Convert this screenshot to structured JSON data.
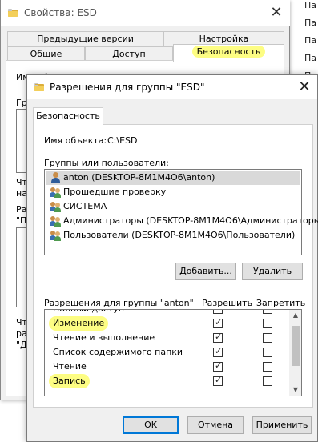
{
  "background_list": {
    "items": [
      "Па",
      "Па",
      "Па",
      "Па",
      "Па",
      "Па"
    ]
  },
  "back_dialog": {
    "title": "Свойства: ESD",
    "close": "✕",
    "tabs": [
      {
        "label": "Предыдущие версии"
      },
      {
        "label": "Настройка"
      },
      {
        "label": "Общие"
      },
      {
        "label": "Доступ"
      },
      {
        "label": "Безопасность"
      }
    ],
    "object_name_partial": "Имя объекта: C:\\ESD",
    "partial_texts": [
      "Группы",
      "Чте",
      "на",
      "Раз",
      "\"П",
      "Чте",
      "ра",
      "\"Д"
    ]
  },
  "front_dialog": {
    "title": "Разрешения для группы \"ESD\"",
    "close": "✕",
    "tab_label": "Безопасность",
    "object_label": "Имя объекта:",
    "object_value": "C:\\ESD",
    "groups_label": "Группы или пользователи:",
    "users": [
      {
        "label": "anton (DESKTOP-8M1M4O6\\anton)",
        "icon": "user-icon",
        "selected": true
      },
      {
        "label": "Прошедшие проверку",
        "icon": "users-group-icon",
        "selected": false
      },
      {
        "label": "СИСТЕМА",
        "icon": "users-group-icon",
        "selected": false
      },
      {
        "label": "Администраторы (DESKTOP-8M1M4O6\\Администраторы)",
        "icon": "users-group-icon",
        "selected": false
      },
      {
        "label": "Пользователи (DESKTOP-8M1M4O6\\Пользователи)",
        "icon": "users-group-icon",
        "selected": false
      }
    ],
    "add_button": "Добавить...",
    "remove_button": "Удалить",
    "permissions_label": "Разрешения для группы \"anton\"",
    "allow_header": "Разрешить",
    "deny_header": "Запретить",
    "permissions": [
      {
        "name": "Полный доступ",
        "allow": true,
        "deny": false,
        "highlight": false
      },
      {
        "name": "Изменение",
        "allow": true,
        "deny": false,
        "highlight": true
      },
      {
        "name": "Чтение и выполнение",
        "allow": true,
        "deny": false,
        "highlight": false
      },
      {
        "name": "Список содержимого папки",
        "allow": true,
        "deny": false,
        "highlight": false
      },
      {
        "name": "Чтение",
        "allow": true,
        "deny": false,
        "highlight": false
      },
      {
        "name": "Запись",
        "allow": true,
        "deny": false,
        "highlight": true
      }
    ],
    "ok_button": "OK",
    "cancel_button": "Отмена",
    "apply_button": "Применить"
  },
  "colors": {
    "highlight": "#fdfd83",
    "default_button_border": "#0078d7",
    "selection": "#d9d9d9"
  }
}
